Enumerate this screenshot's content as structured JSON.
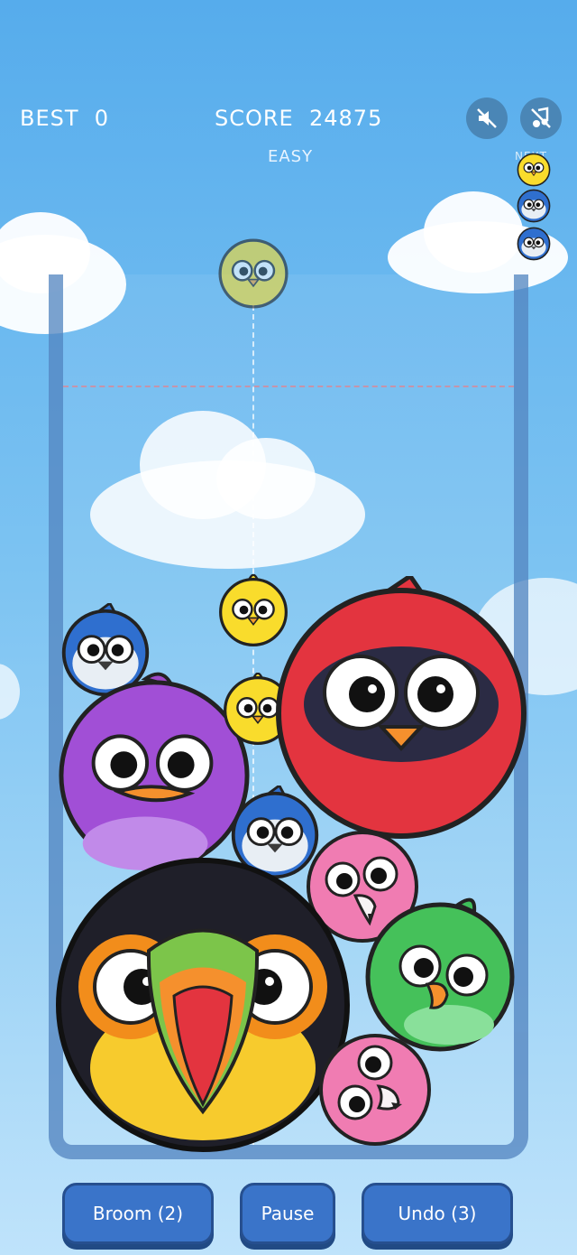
{
  "hud": {
    "best_label": "BEST",
    "best_value": "0",
    "score_label": "SCORE",
    "score_value": "24875",
    "difficulty": "EASY",
    "next_label": "NEXT"
  },
  "controls": {
    "sound_icon": "speaker-muted-icon",
    "music_icon": "music-muted-icon"
  },
  "next_queue": [
    "yellow-chick",
    "blue-jay",
    "blue-jay"
  ],
  "current_drop": "yellow-chick",
  "birds_in_play": [
    "blue-jay",
    "purple-bird",
    "yellow-chick",
    "yellow-chick",
    "red-cardinal",
    "blue-jay",
    "pink-flamingo",
    "toucan",
    "green-parrot",
    "pink-flamingo"
  ],
  "buttons": {
    "broom": "Broom (2)",
    "pause": "Pause",
    "undo": "Undo (3)"
  }
}
